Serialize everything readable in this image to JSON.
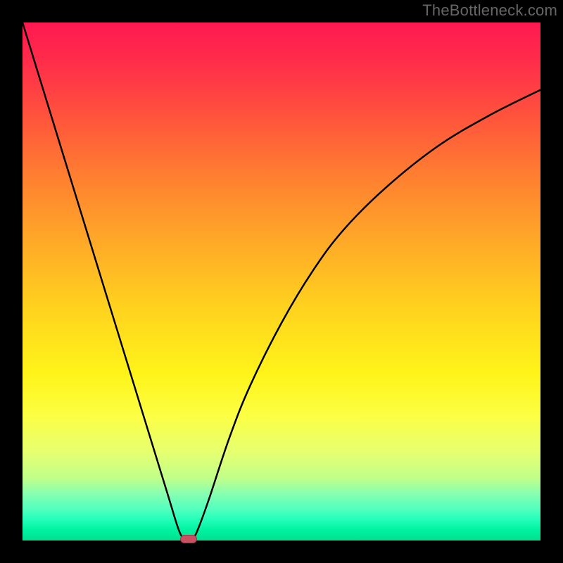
{
  "watermark": "TheBottleneck.com",
  "chart_data": {
    "type": "line",
    "title": "",
    "xlabel": "",
    "ylabel": "",
    "xlim": [
      0,
      100
    ],
    "ylim": [
      0,
      100
    ],
    "grid": false,
    "legend": false,
    "background_gradient": {
      "direction": "vertical",
      "stops": [
        {
          "pos": 0.0,
          "color": "#ff1850"
        },
        {
          "pos": 0.2,
          "color": "#ff5a3a"
        },
        {
          "pos": 0.42,
          "color": "#ffa828"
        },
        {
          "pos": 0.68,
          "color": "#fff41a"
        },
        {
          "pos": 0.88,
          "color": "#c0ff8a"
        },
        {
          "pos": 1.0,
          "color": "#00e090"
        }
      ]
    },
    "series": [
      {
        "name": "bottleneck-curve",
        "color": "#000000",
        "x": [
          0,
          4,
          8,
          12,
          16,
          20,
          24,
          28,
          30,
          31,
          32,
          33,
          34,
          36,
          40,
          44,
          50,
          56,
          62,
          70,
          80,
          90,
          100
        ],
        "values": [
          100,
          87,
          74,
          61,
          48,
          35,
          22,
          9,
          2.5,
          0.5,
          0,
          0.5,
          2.5,
          8,
          20,
          30,
          42,
          52,
          60,
          68,
          76,
          82,
          87
        ]
      }
    ],
    "marker": {
      "name": "optimum-point",
      "x": 32,
      "y": 0,
      "color": "#c85060"
    }
  }
}
